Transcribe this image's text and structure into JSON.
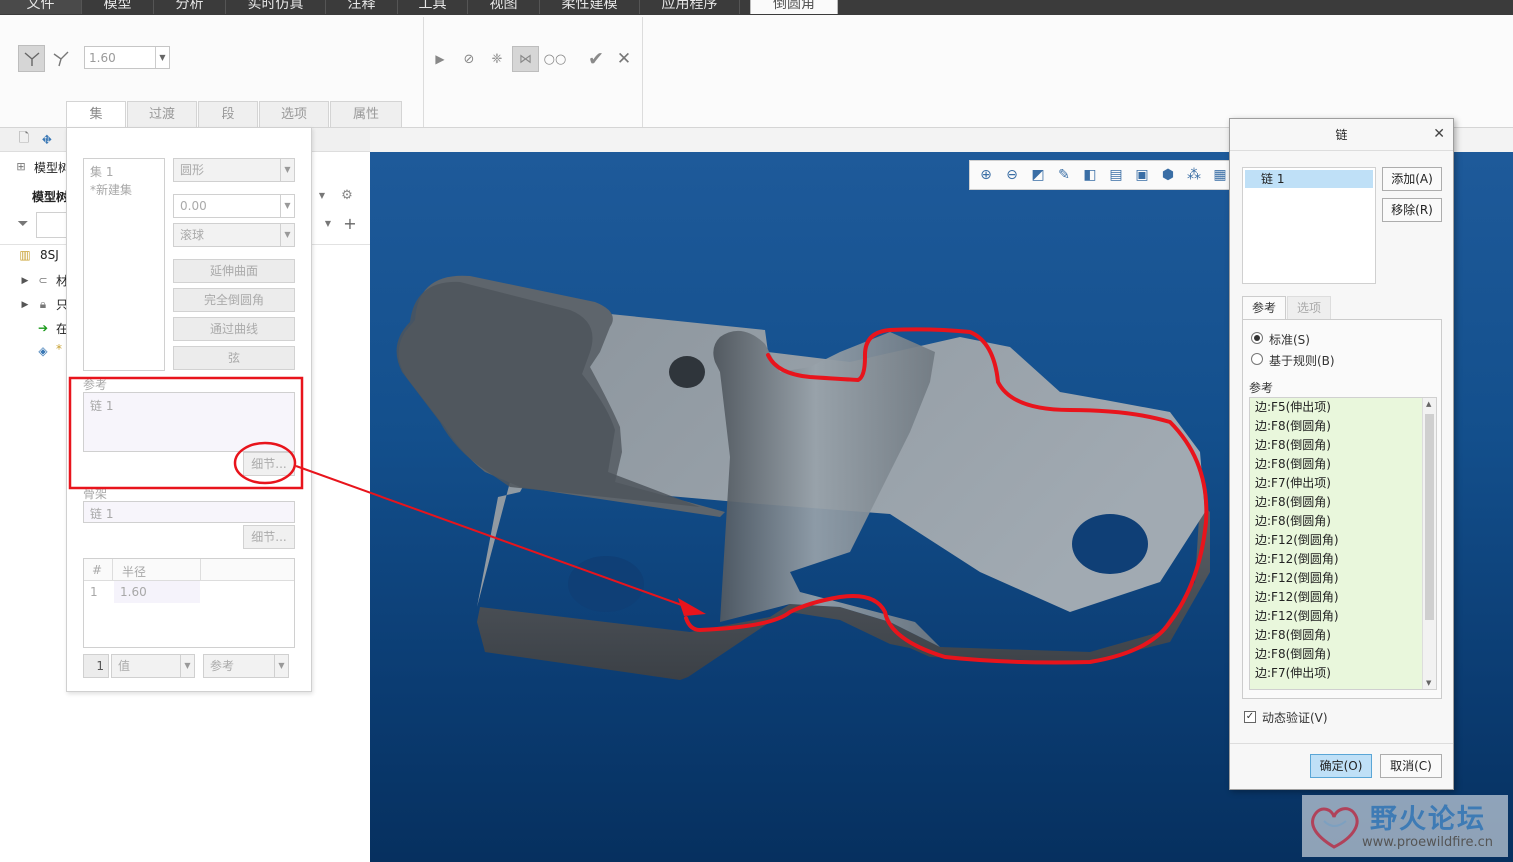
{
  "ribbon_tabs": [
    "文件",
    "模型",
    "分析",
    "实时仿真",
    "注释",
    "工具",
    "视图",
    "柔性建模",
    "应用程序",
    "倒圆角"
  ],
  "ribbon": {
    "radius_value": "1.60",
    "slide_tabs": [
      "集",
      "过渡",
      "段",
      "选项",
      "属性"
    ]
  },
  "left_panel": {
    "header": "模型树",
    "header2": "模型树",
    "tree": [
      {
        "label": "8SJ",
        "icon": "part-icon"
      },
      {
        "label": "材",
        "icon": "material-icon"
      },
      {
        "label": "只",
        "icon": "lock-icon"
      },
      {
        "label": "在",
        "icon": "insert-here-icon"
      },
      {
        "label": "*",
        "icon": "new-feature-icon"
      }
    ]
  },
  "sets_panel": {
    "sets_list": [
      "集 1",
      "*新建集"
    ],
    "shape_combo": "圆形",
    "value_combo": "0.00",
    "method_combo": "滚球",
    "btn_extend_surface": "延伸曲面",
    "btn_full_round": "完全倒圆角",
    "btn_through_curve": "通过曲线",
    "btn_chord": "弦",
    "references_label": "参考",
    "references_value": "链 1",
    "details_btn": "细节...",
    "skeleton_label": "骨架",
    "skeleton_value": "链 1",
    "skeleton_details_btn": "细节...",
    "table_headers": [
      "#",
      "半径"
    ],
    "table_rows": [
      {
        "n": "1",
        "r": "1.60"
      }
    ],
    "bottom_num": "1",
    "bottom_value_combo": "值",
    "bottom_ref_combo": "参考"
  },
  "chain_dialog": {
    "title": "链",
    "chain_item": "链 1",
    "add_btn": "添加(A)",
    "remove_btn": "移除(R)",
    "tabs": [
      "参考",
      "选项"
    ],
    "radio_standard": "标准(S)",
    "radio_rule": "基于规则(B)",
    "ref_label": "参考",
    "ref_items": [
      "边:F5(伸出项)",
      "边:F8(倒圆角)",
      "边:F8(倒圆角)",
      "边:F8(倒圆角)",
      "边:F7(伸出项)",
      "边:F8(倒圆角)",
      "边:F8(倒圆角)",
      "边:F12(倒圆角)",
      "边:F12(倒圆角)",
      "边:F12(倒圆角)",
      "边:F12(倒圆角)",
      "边:F12(倒圆角)",
      "边:F8(倒圆角)",
      "边:F8(倒圆角)",
      "边:F7(伸出项)"
    ],
    "dynamic_validate": "动态验证(V)",
    "ok_btn": "确定(O)",
    "cancel_btn": "取消(C)"
  },
  "watermark": {
    "title": "野火论坛",
    "url": "www.proewildfire.cn"
  },
  "colors": {
    "highlight_red": "#e8141c",
    "viewport_top": "#1e5a9a",
    "viewport_bottom": "#06305f",
    "ref_list_bg": "#e9f7dc",
    "selection_blue": "#bfe0f7"
  }
}
